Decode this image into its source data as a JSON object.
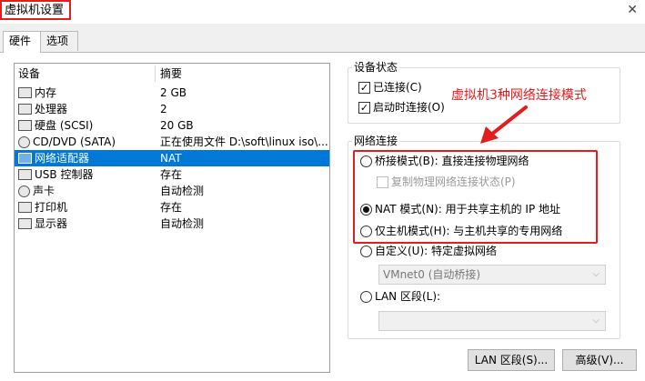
{
  "window": {
    "title": "虚拟机设置",
    "close_glyph": "✕"
  },
  "tabs": [
    {
      "label": "硬件"
    },
    {
      "label": "选项"
    }
  ],
  "device_list": {
    "headers": {
      "device": "设备",
      "summary": "摘要"
    },
    "rows": [
      {
        "device": "内存",
        "summary": "2 GB",
        "icon": "memory-icon"
      },
      {
        "device": "处理器",
        "summary": "2",
        "icon": "processor-icon"
      },
      {
        "device": "硬盘 (SCSI)",
        "summary": "20 GB",
        "icon": "hard-disk-icon"
      },
      {
        "device": "CD/DVD (SATA)",
        "summary": "正在使用文件 D:\\soft\\linux iso\\...",
        "icon": "cd-dvd-icon"
      },
      {
        "device": "网络适配器",
        "summary": "NAT",
        "icon": "network-adapter-icon"
      },
      {
        "device": "USB 控制器",
        "summary": "存在",
        "icon": "usb-icon"
      },
      {
        "device": "声卡",
        "summary": "自动检测",
        "icon": "sound-card-icon"
      },
      {
        "device": "打印机",
        "summary": "存在",
        "icon": "printer-icon"
      },
      {
        "device": "显示器",
        "summary": "自动检测",
        "icon": "display-icon"
      }
    ],
    "selected_index": 4
  },
  "device_status": {
    "legend": "设备状态",
    "connected": {
      "label": "已连接(C)",
      "checked": true
    },
    "connect_at_power_on": {
      "label": "启动时连接(O)",
      "checked": true
    }
  },
  "network_connection": {
    "legend": "网络连接",
    "bridged": {
      "label": "桥接模式(B): 直接连接物理网络",
      "selected": false
    },
    "replicate": {
      "label": "复制物理网络连接状态(P)",
      "checked": false
    },
    "nat": {
      "label": "NAT 模式(N): 用于共享主机的 IP 地址",
      "selected": true
    },
    "host_only": {
      "label": "仅主机模式(H): 与主机共享的专用网络",
      "selected": false
    },
    "custom": {
      "label": "自定义(U): 特定虚拟网络",
      "selected": false
    },
    "vmnet_select": {
      "value": "VMnet0 (自动桥接)"
    },
    "lan_segment": {
      "label": "LAN 区段(L):",
      "selected": false
    },
    "lan_select": {
      "value": ""
    }
  },
  "buttons": {
    "lan_segments": "LAN 区段(S)...",
    "advanced": "高级(V)..."
  },
  "annotation": {
    "text": "虚拟机3种网络连接模式",
    "color": "#e21d1d"
  },
  "colors": {
    "selection": "#0078d7",
    "highlight": "#e21d1d"
  }
}
